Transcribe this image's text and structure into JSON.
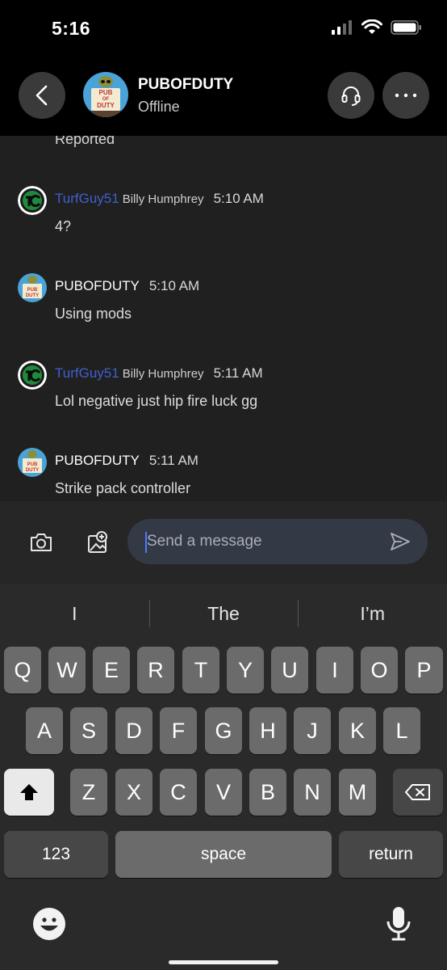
{
  "status_bar": {
    "time": "5:16"
  },
  "header": {
    "contact_name": "PUBOFDUTY",
    "contact_status": "Offline",
    "avatar_text_top": "PUB",
    "avatar_text_mid": "OF",
    "avatar_text_bottom": "DUTY"
  },
  "chat": {
    "clipped_previous": "Reported",
    "messages": [
      {
        "gamertag": "TurfGuy51",
        "realname": "Billy Humphrey",
        "time": "5:10 AM",
        "body": "4?"
      },
      {
        "gamertag": "PUBOFDUTY",
        "realname": "",
        "time": "5:10 AM",
        "body": "Using mods"
      },
      {
        "gamertag": "TurfGuy51",
        "realname": "Billy Humphrey",
        "time": "5:11 AM",
        "body": "Lol negative just hip fire luck gg"
      },
      {
        "gamertag": "PUBOFDUTY",
        "realname": "",
        "time": "5:11 AM",
        "body": "Strike pack controller"
      }
    ]
  },
  "composer": {
    "placeholder": "Send a message"
  },
  "keyboard": {
    "suggestions": [
      "I",
      "The",
      "I’m"
    ],
    "row1": [
      "Q",
      "W",
      "E",
      "R",
      "T",
      "Y",
      "U",
      "I",
      "O",
      "P"
    ],
    "row2": [
      "A",
      "S",
      "D",
      "F",
      "G",
      "H",
      "J",
      "K",
      "L"
    ],
    "row3": [
      "Z",
      "X",
      "C",
      "V",
      "B",
      "N",
      "M"
    ],
    "numbers_label": "123",
    "space_label": "space",
    "return_label": "return"
  },
  "colors": {
    "gamertag_blue": "#3f5fd2",
    "input_bg": "#333a46",
    "caret": "#4d79ff"
  }
}
